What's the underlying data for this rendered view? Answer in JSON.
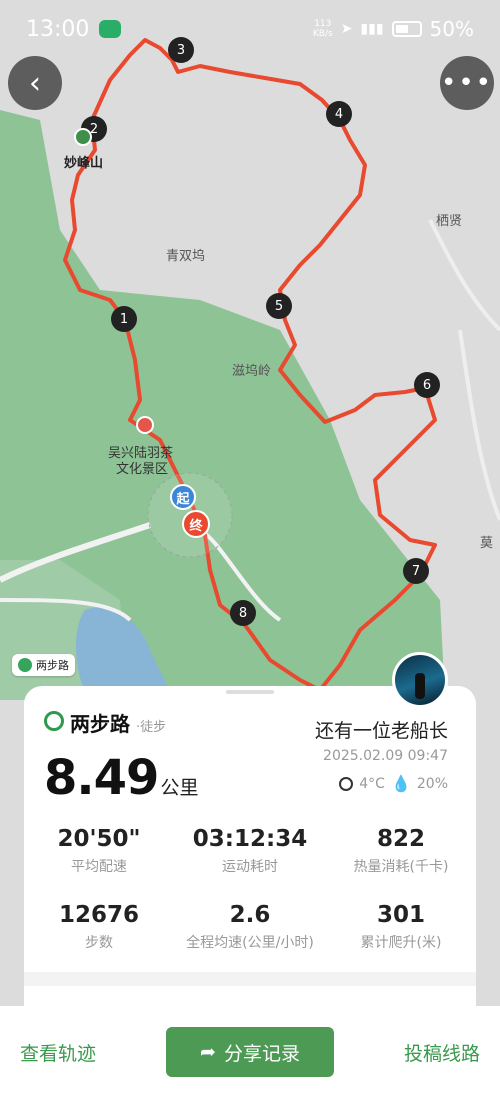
{
  "status_bar": {
    "time": "13:00",
    "netspeed_value": "113",
    "netspeed_unit": "KB/s",
    "battery": "50%"
  },
  "map": {
    "labels": {
      "miaofeng": "妙峰山",
      "qingshuangwu": "青双坞",
      "zihuling": "滋坞岭",
      "qixian": "栖贤",
      "tea_scenic_line1": "吴兴陆羽茶",
      "tea_scenic_line2": "文化景区",
      "edge": "莫"
    },
    "waypoints": [
      "1",
      "2",
      "3",
      "4",
      "5",
      "6",
      "7",
      "8"
    ],
    "start_label": "起",
    "end_label": "终",
    "brand_badge": "两步路"
  },
  "colors": {
    "route": "#e8492f",
    "green": "#7cba87",
    "accent": "#3a9a4c"
  },
  "card": {
    "brand_name": "两步路",
    "brand_sub": "·徒步",
    "user_name": "还有一位老船长",
    "distance_value": "8.49",
    "distance_unit": "公里",
    "datetime": "2025.02.09 09:47",
    "temperature": "4°C",
    "humidity": "20%",
    "stats": [
      {
        "value": "20'50\"",
        "label": "平均配速"
      },
      {
        "value": "03:12:34",
        "label": "运动耗时"
      },
      {
        "value": "822",
        "label": "热量消耗(千卡)"
      },
      {
        "value": "12676",
        "label": "步数"
      },
      {
        "value": "2.6",
        "label": "全程均速(公里/小时)"
      },
      {
        "value": "301",
        "label": "累计爬升(米)"
      }
    ]
  },
  "bottom_bar": {
    "view_track": "查看轨迹",
    "share": "分享记录",
    "submit_route": "投稿线路"
  }
}
